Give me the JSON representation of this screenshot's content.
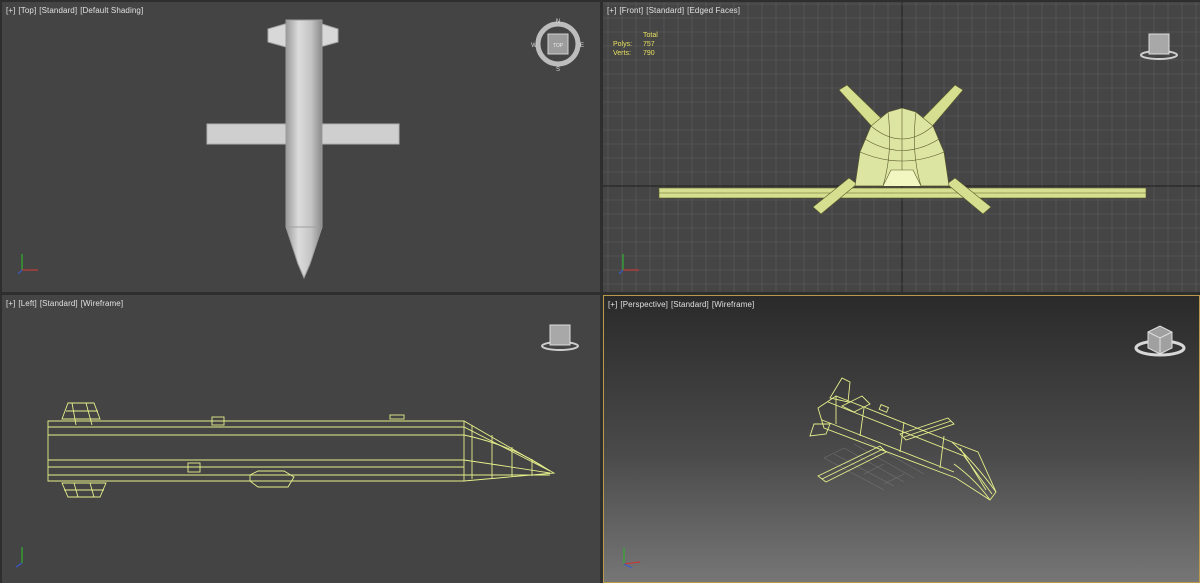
{
  "viewports": {
    "top": {
      "menu": "[+]",
      "view": "[Top]",
      "shading_mode": "[Standard]",
      "display": "[Default Shading]",
      "compass": {
        "n": "N",
        "s": "S",
        "e": "E",
        "w": "W",
        "cube_face": "TOP"
      }
    },
    "front": {
      "menu": "[+]",
      "view": "[Front]",
      "shading_mode": "[Standard]",
      "display": "[Edged Faces]",
      "stats": {
        "header": "Total",
        "polys_label": "Polys:",
        "polys_value": "757",
        "verts_label": "Verts:",
        "verts_value": "790"
      }
    },
    "left": {
      "menu": "[+]",
      "view": "[Left]",
      "shading_mode": "[Standard]",
      "display": "[Wireframe]"
    },
    "perspective": {
      "menu": "[+]",
      "view": "[Perspective]",
      "shading_mode": "[Standard]",
      "display": "[Wireframe]",
      "active": true
    }
  },
  "colors": {
    "viewport_bg": "#444444",
    "wireframe": "#e6ef8a",
    "grid": "#5c5c5c",
    "active_border": "#b89a4a",
    "stats_text": "#e8e060"
  }
}
